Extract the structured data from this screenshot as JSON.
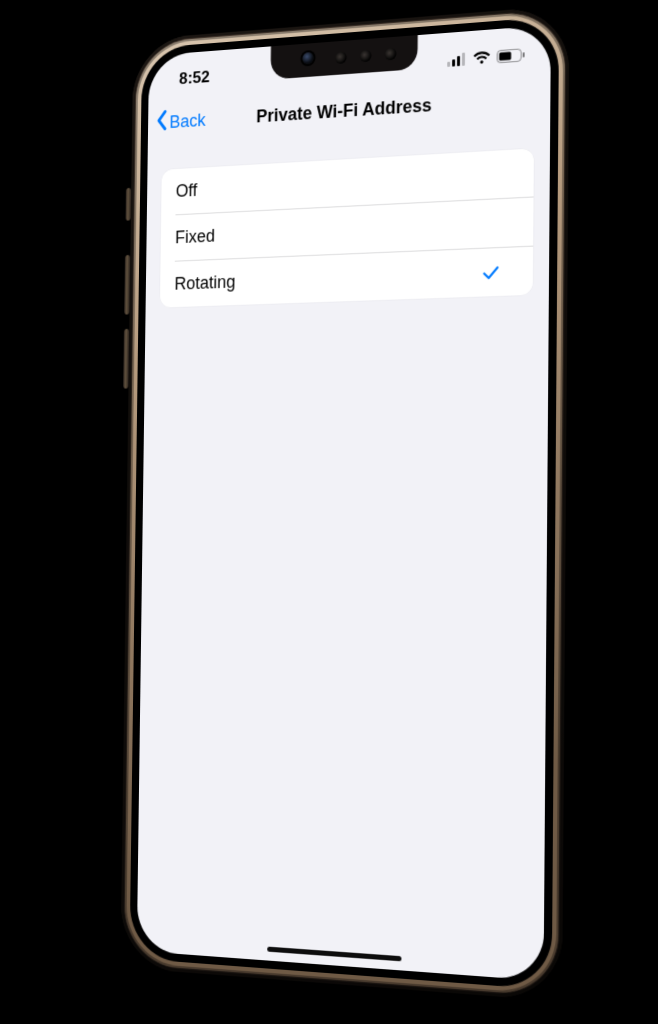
{
  "status": {
    "time": "8:52"
  },
  "nav": {
    "back_label": "Back",
    "title": "Private Wi-Fi Address"
  },
  "options": {
    "items": [
      {
        "label": "Off",
        "selected": false
      },
      {
        "label": "Fixed",
        "selected": false
      },
      {
        "label": "Rotating",
        "selected": true
      }
    ]
  }
}
